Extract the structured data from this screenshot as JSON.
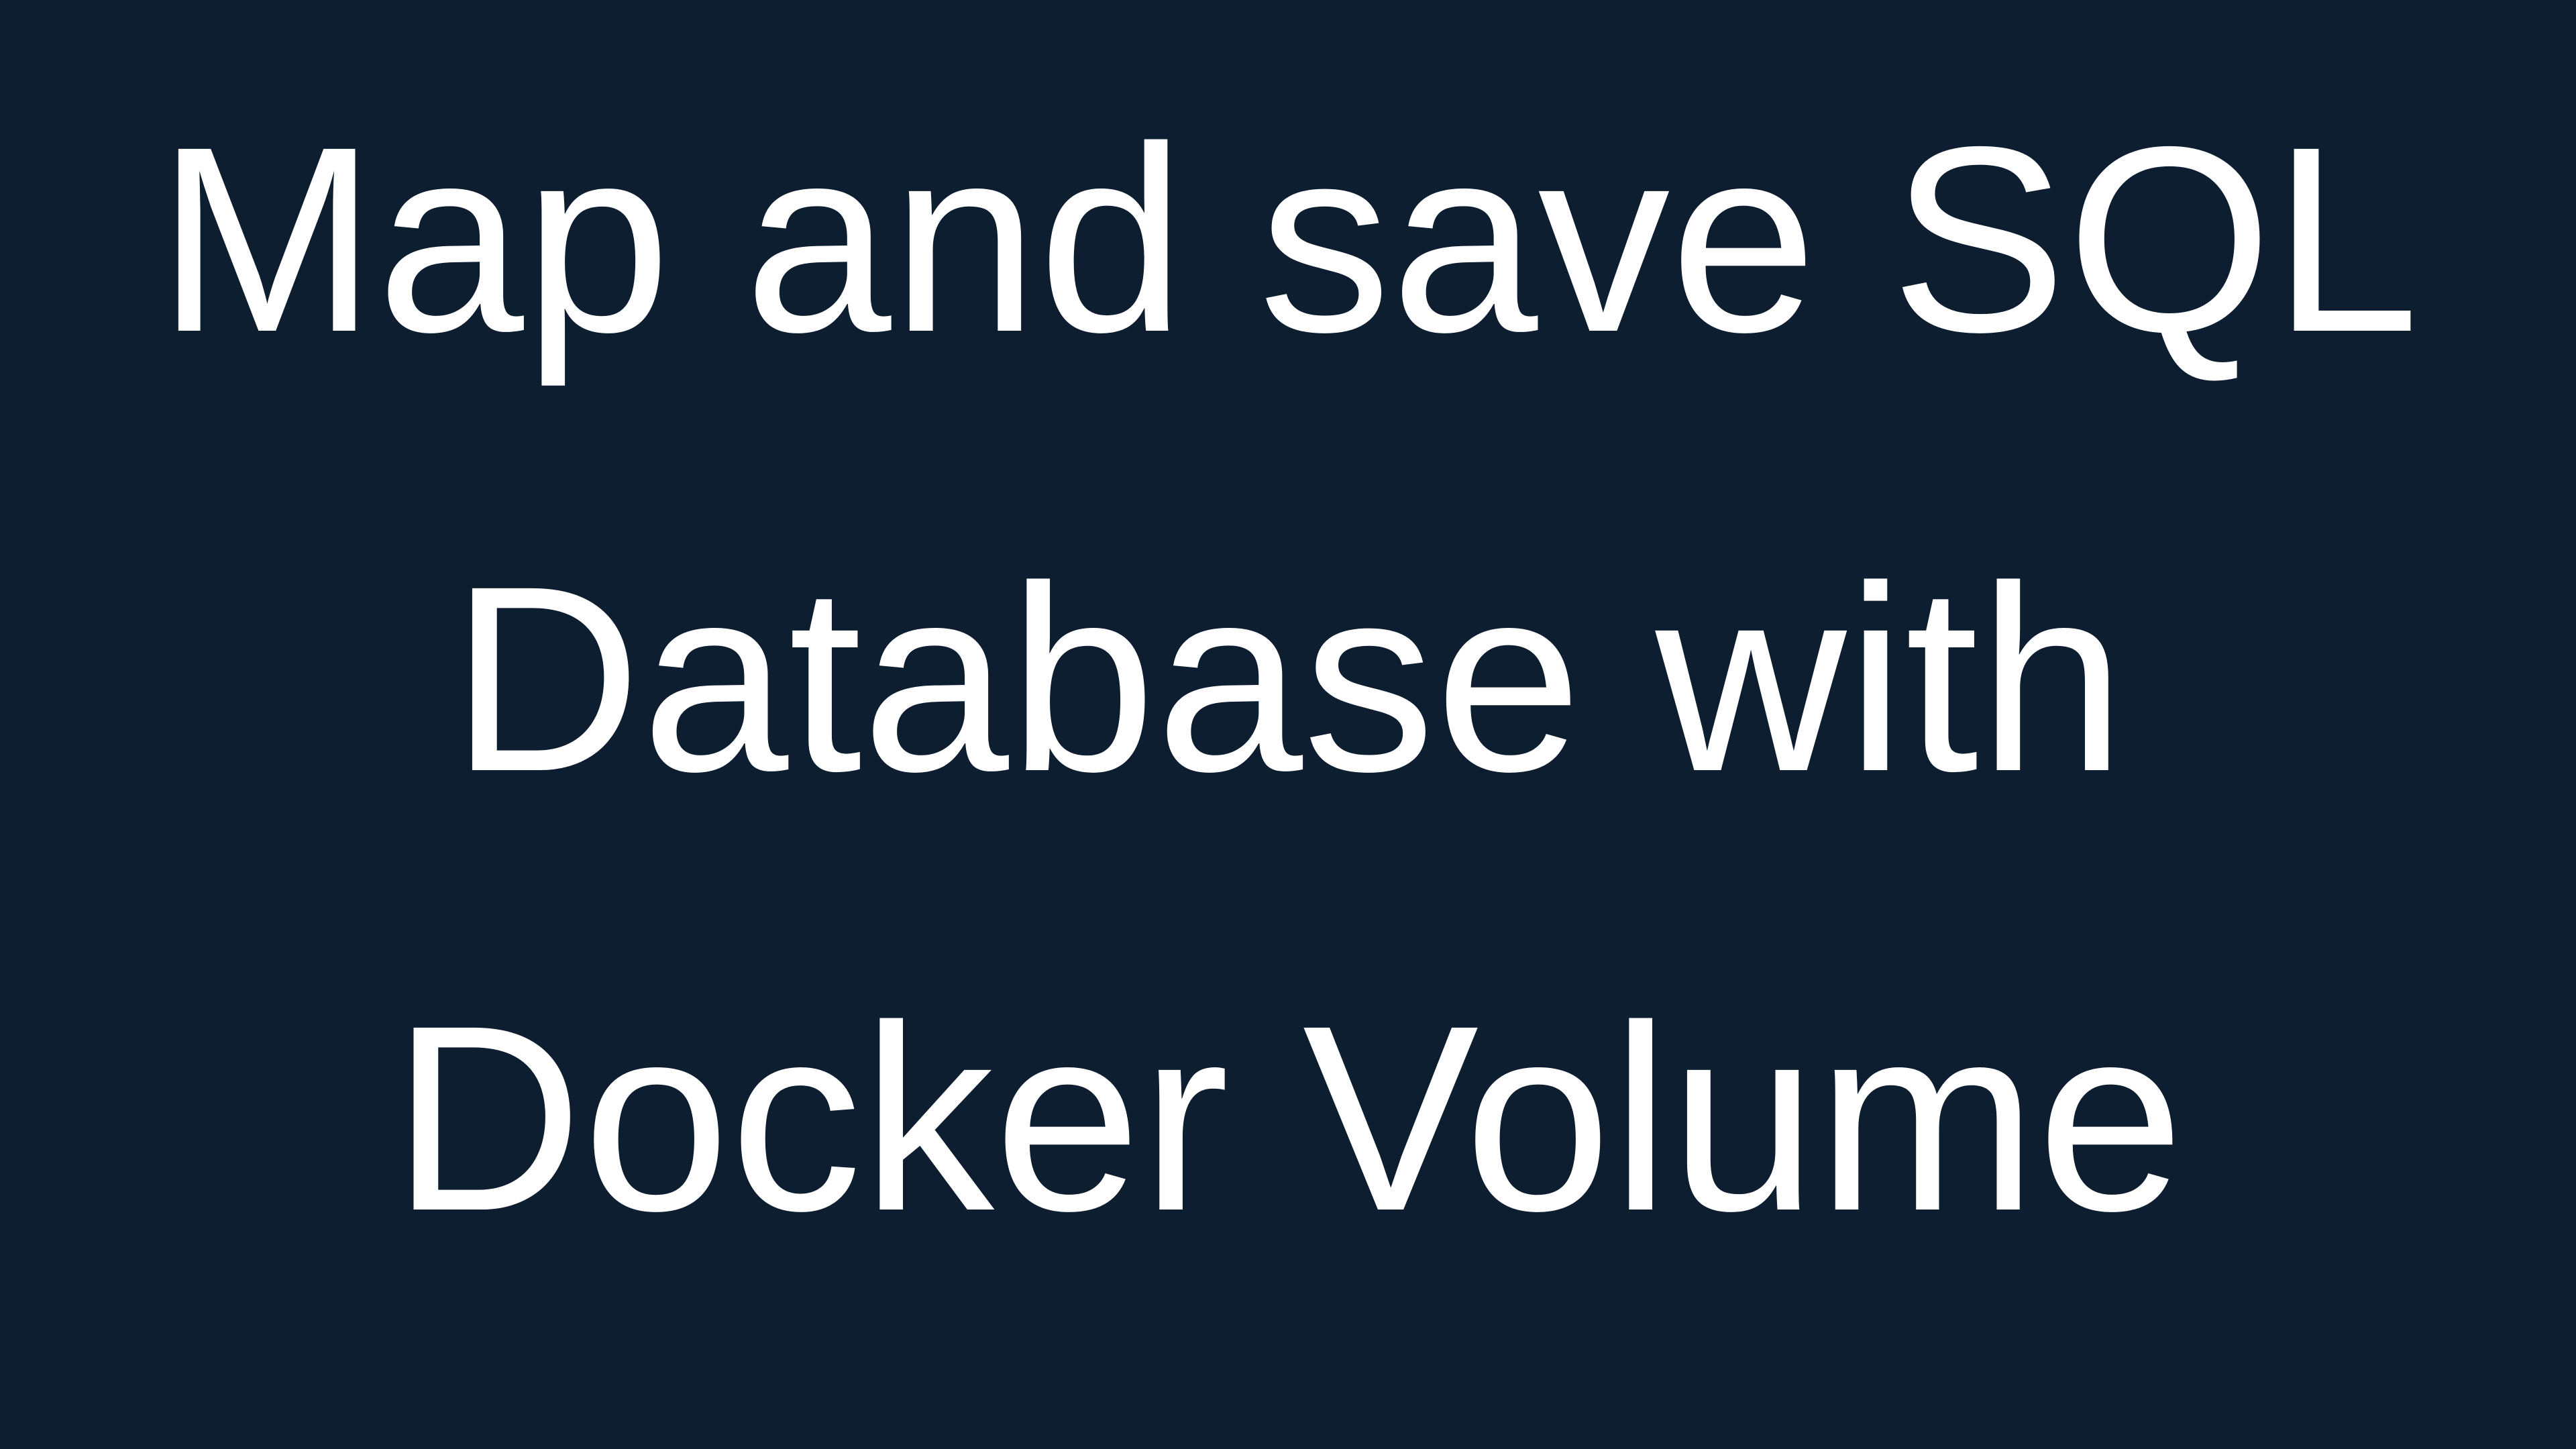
{
  "title": {
    "lines": [
      "Map and save SQL",
      "Database with",
      "Docker Volume"
    ]
  },
  "colors": {
    "background": "#0d1e31",
    "text": "#ffffff"
  }
}
